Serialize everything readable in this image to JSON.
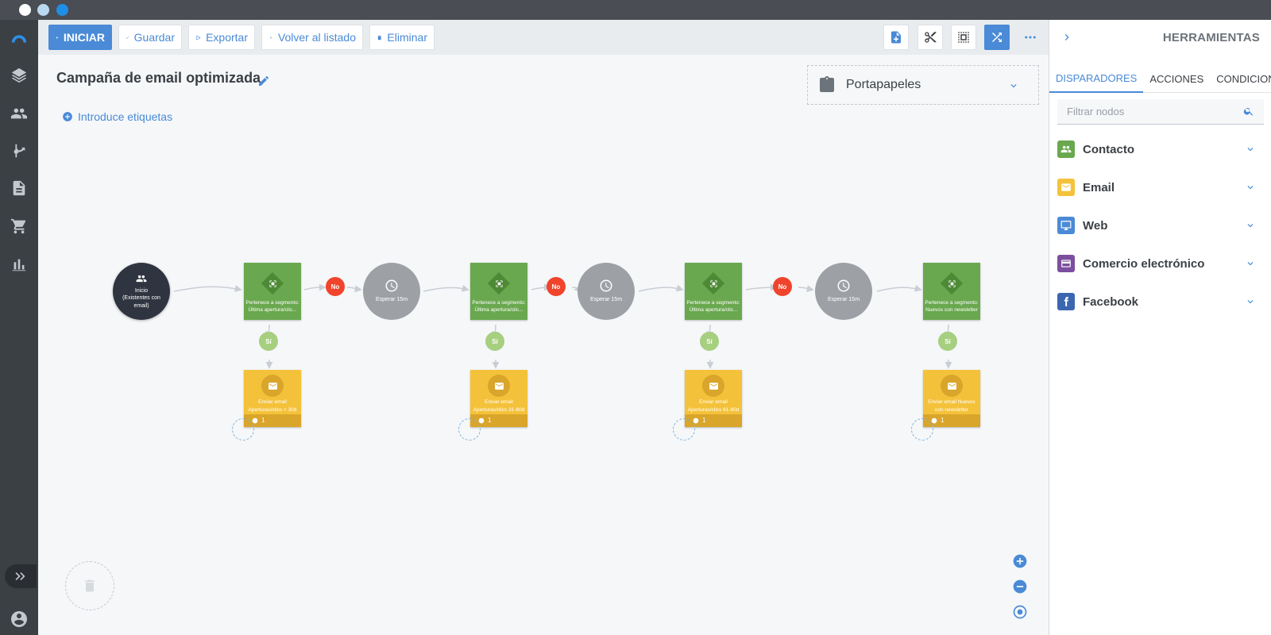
{
  "toolbar": {
    "start_label": "INICIAR",
    "save_label": "Guardar",
    "export_label": "Exportar",
    "back_label": "Volver al listado",
    "delete_label": "Eliminar"
  },
  "campaign": {
    "title": "Campaña de email optimizada",
    "tags_label": "Introduce etiquetas"
  },
  "clipboard": {
    "label": "Portapapeles"
  },
  "flow": {
    "start": {
      "line1": "Inicio",
      "line2": "(Existentes con",
      "line3": "email)"
    },
    "conditions": [
      {
        "line1": "Pertenece a segmento:",
        "line2": "Última apertura/clic..."
      },
      {
        "line1": "Pertenece a segmento:",
        "line2": "Última apertura/clic..."
      },
      {
        "line1": "Pertenece a segmento:",
        "line2": "Última apertura/clic..."
      },
      {
        "line1": "Pertenece a segmento:",
        "line2": "Nuevos con newsletter"
      }
    ],
    "waits": [
      {
        "label": "Esperar 15m"
      },
      {
        "label": "Esperar 15m"
      },
      {
        "label": "Esperar 15m"
      }
    ],
    "emails": [
      {
        "line1": "Enviar email",
        "line2": "Aperturas/clics < 30d",
        "count": "1"
      },
      {
        "line1": "Enviar email",
        "line2": "Aperturas/clics 31-60d",
        "count": "1"
      },
      {
        "line1": "Enviar email",
        "line2": "Aperturas/clics 61-90d",
        "count": "1"
      },
      {
        "line1": "Enviar email Nuevos",
        "line2": "con newsletter",
        "count": "1"
      }
    ],
    "no_label": "No",
    "yes_label": "Sí"
  },
  "panel": {
    "title": "HERRAMIENTAS",
    "tabs": [
      {
        "label": "DISPARADORES"
      },
      {
        "label": "ACCIONES"
      },
      {
        "label": "CONDICIONES"
      }
    ],
    "search_placeholder": "Filtrar nodos",
    "categories": [
      {
        "label": "Contacto",
        "color": "#6aa84f"
      },
      {
        "label": "Email",
        "color": "#f4c23a"
      },
      {
        "label": "Web",
        "color": "#4a8ad6"
      },
      {
        "label": "Comercio electrónico",
        "color": "#7b4f9e"
      },
      {
        "label": "Facebook",
        "color": "#3b66b0"
      }
    ]
  },
  "colors": {
    "accent": "#4a8ad6",
    "condition": "#6aa84f",
    "email": "#f4c23a",
    "wait": "#9da1a6",
    "no_badge": "#f0442c",
    "yes_badge": "#a6cf7f"
  }
}
